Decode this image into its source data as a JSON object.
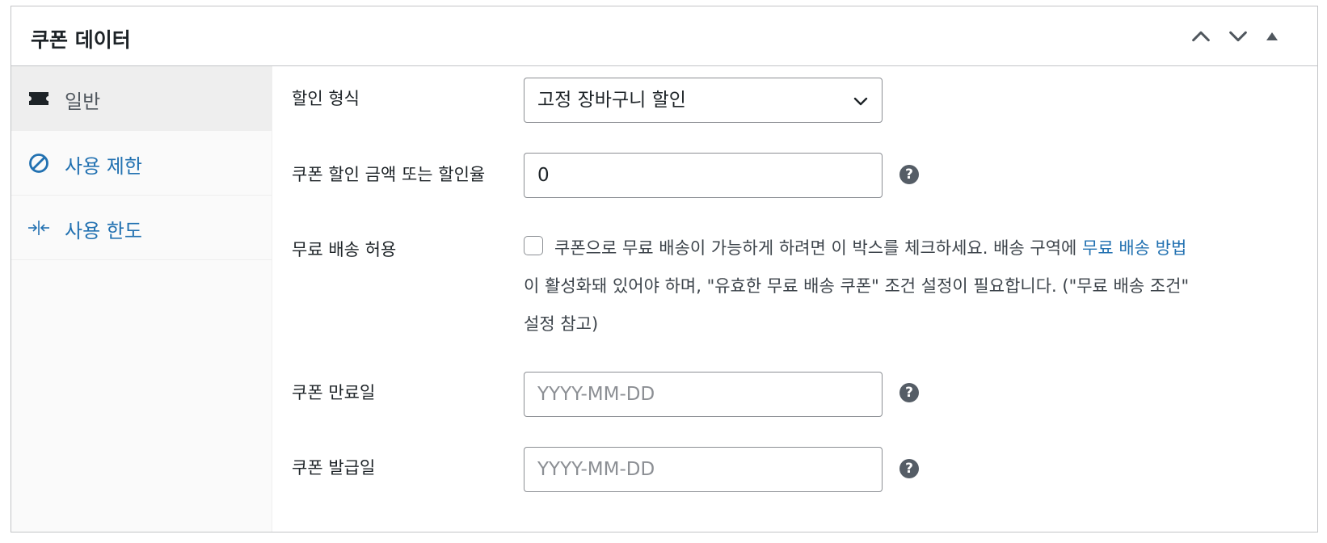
{
  "header": {
    "title": "쿠폰 데이터"
  },
  "tabs": [
    {
      "label": "일반",
      "icon": "ticket-icon"
    },
    {
      "label": "사용 제한",
      "icon": "block-icon"
    },
    {
      "label": "사용 한도",
      "icon": "arrows-in-icon"
    }
  ],
  "fields": {
    "discount_type": {
      "label": "할인 형식",
      "value": "고정 장바구니 할인"
    },
    "amount": {
      "label": "쿠폰 할인 금액 또는 할인율",
      "value": "0",
      "help": "?"
    },
    "free_shipping": {
      "label": "무료 배송 허용",
      "line1_prefix": "쿠폰으로 무료 배송이 가능하게 하려면 이 박스를 체크하세요. 배송 구역에 ",
      "line1_link": "무료 배송 방법",
      "line2": "이 활성화돼 있어야 하며, \"유효한 무료 배송 쿠폰\" 조건 설정이 필요합니다. (\"무료 배송 조건\"",
      "line3": "설정 참고)",
      "checked": false
    },
    "expiry_date": {
      "label": "쿠폰 만료일",
      "placeholder": "YYYY-MM-DD",
      "help": "?"
    },
    "issue_date": {
      "label": "쿠폰 발급일",
      "placeholder": "YYYY-MM-DD",
      "help": "?"
    }
  },
  "colors": {
    "link": "#2271b1",
    "active_tab_bg": "#eeeeee",
    "border": "#c3c4c7"
  }
}
